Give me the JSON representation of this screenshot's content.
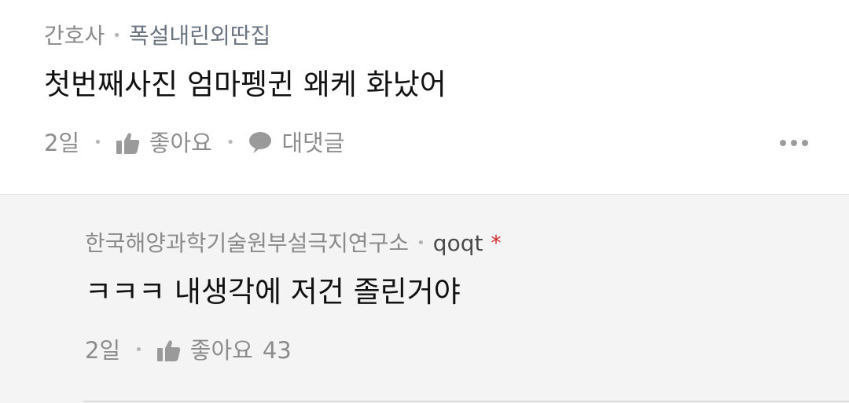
{
  "comment": {
    "author": "간호사",
    "community": "폭설내린외딴집",
    "text": "첫번째사진 엄마펭귄 왜케 화났어",
    "time": "2일",
    "like_label": "좋아요",
    "reply_label": "대댓글",
    "more_icon": "more-horizontal-icon"
  },
  "reply": {
    "author": "한국해양과학기술원부설극지연구소",
    "username": "qoqt",
    "badge": "*",
    "text": "ㅋㅋㅋ 내생각에 저건 졸린거야",
    "time": "2일",
    "like_label": "좋아요",
    "like_count": "43"
  },
  "icons": {
    "like": "thumbs-up-icon",
    "reply": "speech-bubble-icon"
  },
  "colors": {
    "reply_background": "#f4f4f4",
    "star": "#d42a2a"
  }
}
